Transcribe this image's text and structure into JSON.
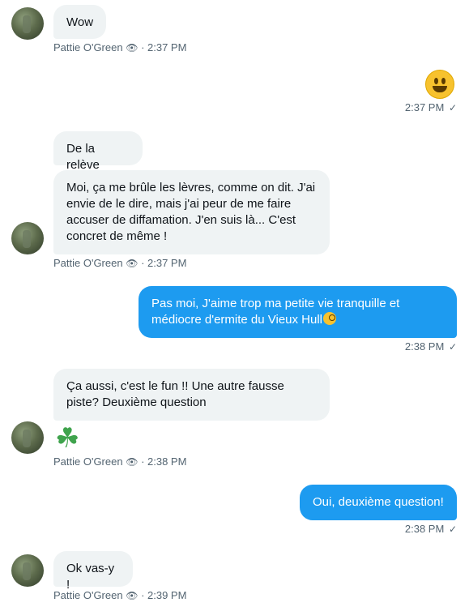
{
  "contact": {
    "name": "Pattie O'Green",
    "eye_icon": "eye-icon"
  },
  "messages": [
    {
      "text": "Wow",
      "time": "2:37 PM"
    },
    {
      "emoji": "grinning-face-emoji",
      "time": "2:37 PM"
    },
    {
      "text": "De la relève"
    },
    {
      "text": "Moi, ça me brûle les lèvres, comme on dit. J'ai envie de le dire, mais j'ai peur de me faire accuser de diffamation. J'en suis là... C'est concret de même !",
      "time": "2:37 PM"
    },
    {
      "text": "Pas moi, J'aime trop ma petite vie tranquille et médiocre d'ermite du Vieux Hull",
      "time": "2:38 PM"
    },
    {
      "text": "Ça aussi, c'est le fun !! Une autre fausse piste? Deuxième question"
    },
    {
      "emoji": "☘️",
      "time": "2:38 PM"
    },
    {
      "text": "Oui, deuxième question!",
      "time": "2:38 PM"
    },
    {
      "text": "Ok vas-y !",
      "time": "2:39 PM"
    }
  ],
  "glyphs": {
    "eye": "👁",
    "check": "✓",
    "clover": "☘"
  },
  "colors": {
    "incoming_bg": "#eff3f4",
    "outgoing_bg": "#1d9bf0",
    "meta_text": "#536471"
  }
}
